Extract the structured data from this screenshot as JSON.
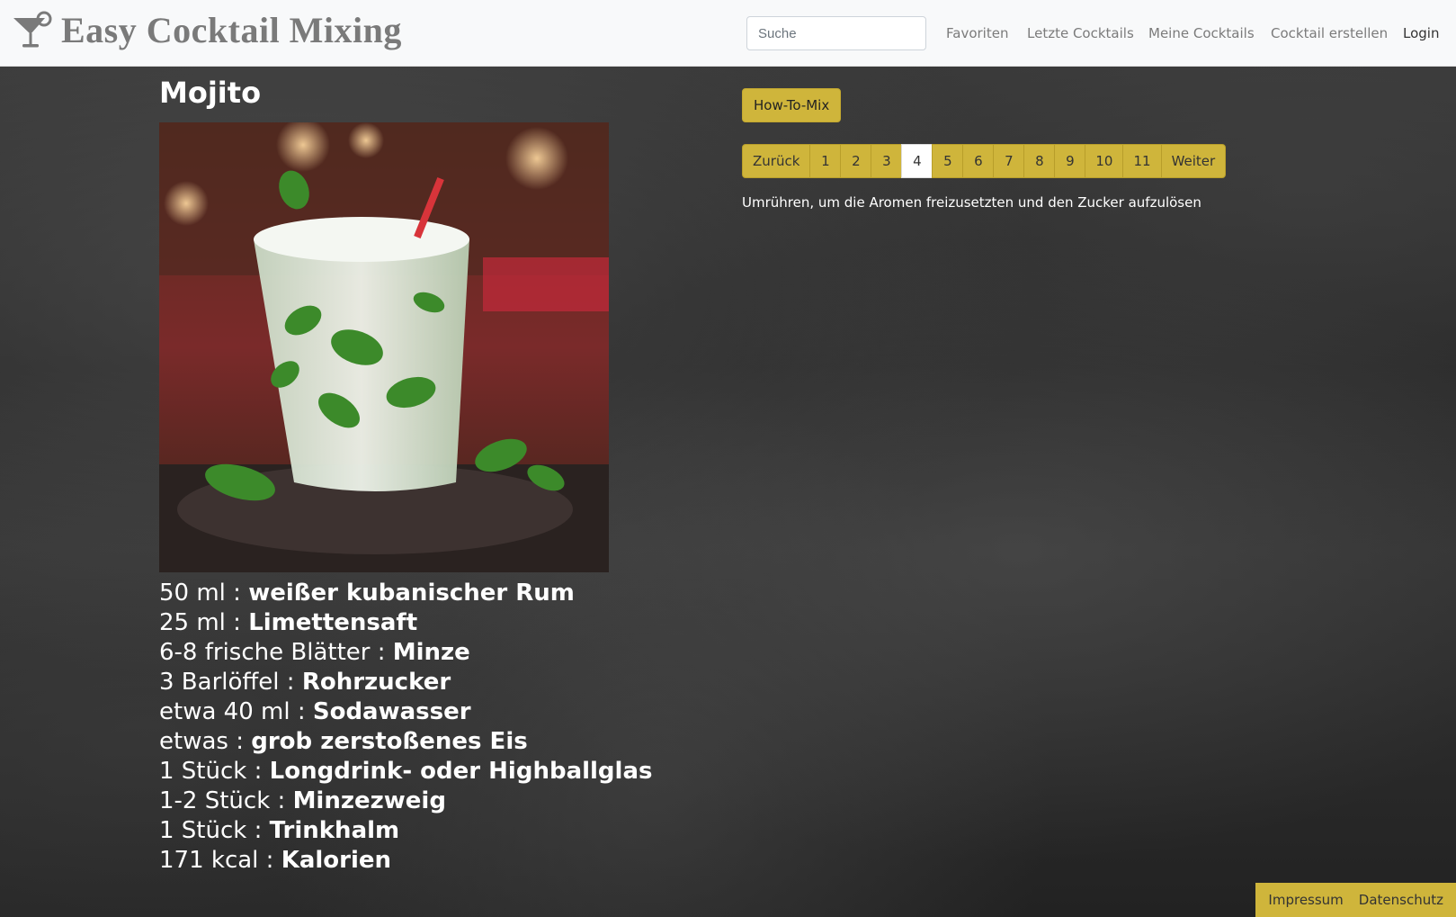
{
  "navbar": {
    "brand_icon": "cocktail-glass-icon",
    "brand_title": "Easy Cocktail Mixing",
    "search_placeholder": "Suche",
    "links": {
      "favoriten": "Favoriten",
      "letzte": "Letzte Cocktails",
      "meine": "Meine Cocktails",
      "erstellen": "Cocktail erstellen",
      "login": "Login"
    }
  },
  "cocktail": {
    "title": "Mojito",
    "ingredients": [
      {
        "amount": "50 ml",
        "name": "weißer kubanischer Rum"
      },
      {
        "amount": "25 ml",
        "name": "Limettensaft"
      },
      {
        "amount": "6-8 frische Blätter",
        "name": "Minze"
      },
      {
        "amount": "3 Barlöffel",
        "name": "Rohrzucker"
      },
      {
        "amount": "etwa 40 ml",
        "name": "Sodawasser"
      },
      {
        "amount": "etwas",
        "name": "grob zerstoßenes Eis"
      },
      {
        "amount": "1 Stück",
        "name": "Longdrink- oder Highballglas"
      },
      {
        "amount": "1-2 Stück",
        "name": "Minzezweig"
      },
      {
        "amount": "1 Stück",
        "name": "Trinkhalm"
      },
      {
        "amount": "171 kcal",
        "name": "Kalorien"
      }
    ],
    "separator": ":"
  },
  "howto": {
    "button_label": "How-To-Mix",
    "pagination": {
      "prev": "Zurück",
      "pages": [
        "1",
        "2",
        "3",
        "4",
        "5",
        "6",
        "7",
        "8",
        "9",
        "10",
        "11"
      ],
      "active_page": "4",
      "next": "Weiter"
    },
    "step_text": "Umrühren, um die Aromen freizusetzten und den Zucker aufzulösen"
  },
  "footer": {
    "impressum": "Impressum",
    "datenschutz": "Datenschutz"
  },
  "colors": {
    "accent": "#cfb53b",
    "navbar_bg": "#f8f9fa",
    "brand_text": "#7a7a7a",
    "background": "#2b2b2b"
  }
}
